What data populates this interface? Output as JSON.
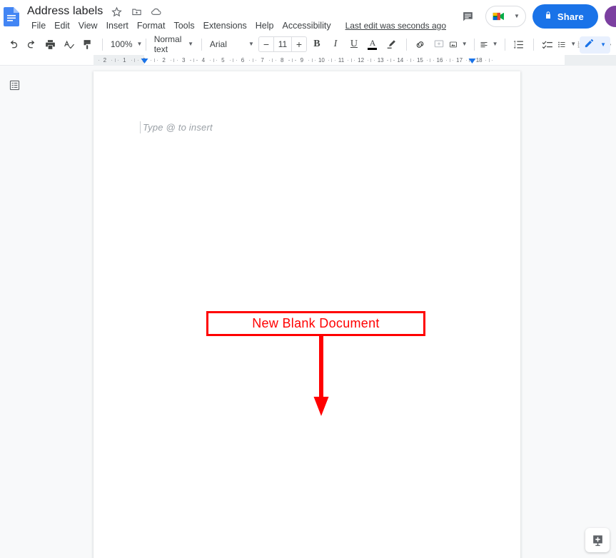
{
  "header": {
    "doc_icon": "google-docs-icon",
    "title": "Address labels",
    "star_icon": "star-icon",
    "move_icon": "move-to-folder-icon",
    "cloud_icon": "cloud-saved-icon",
    "menus": [
      "File",
      "Edit",
      "View",
      "Insert",
      "Format",
      "Tools",
      "Extensions",
      "Help",
      "Accessibility"
    ],
    "last_edit": "Last edit was seconds ago",
    "comment_icon": "comment-history-icon",
    "meet_icon": "google-meet-icon",
    "share_label": "Share",
    "share_lock_icon": "lock-icon",
    "avatar": "user-avatar",
    "accent_blue": "#1a73e8"
  },
  "toolbar": {
    "undo": "undo-icon",
    "redo": "redo-icon",
    "print": "print-icon",
    "spellcheck": "spellcheck-icon",
    "paint_format": "paint-format-icon",
    "zoom_value": "100%",
    "style_value": "Normal text",
    "font_value": "Arial",
    "font_size_decrease": "−",
    "font_size_value": "11",
    "font_size_increase": "+",
    "bold": "B",
    "italic": "I",
    "underline": "U",
    "text_color": "A",
    "highlight": "highlight-pen-icon",
    "link": "insert-link-icon",
    "comment": "add-comment-icon",
    "image": "insert-image-icon",
    "align": "align-left-icon",
    "line_spacing": "line-spacing-icon",
    "checklist": "checklist-icon",
    "bulleted_list": "bulleted-list-icon",
    "numbered_list": "numbered-list-icon",
    "more": "more-options-icon",
    "editing_mode": "editing-pencil-icon"
  },
  "ruler": {
    "labels": [
      "2",
      "1",
      "1",
      "2",
      "3",
      "4",
      "5",
      "6",
      "7",
      "8",
      "9",
      "10",
      "11",
      "12",
      "13",
      "14",
      "15",
      "16",
      "17",
      "18"
    ],
    "left_indent_marker": "left-indent-marker",
    "right_indent_marker": "right-indent-marker"
  },
  "sidebar": {
    "outline_icon": "document-outline-icon"
  },
  "document": {
    "placeholder": "Type @ to insert"
  },
  "annotation": {
    "label": "New Blank Document",
    "color": "#ff0000",
    "arrow": "down-arrow"
  },
  "footer": {
    "explore_icon": "explore-add-icon"
  }
}
